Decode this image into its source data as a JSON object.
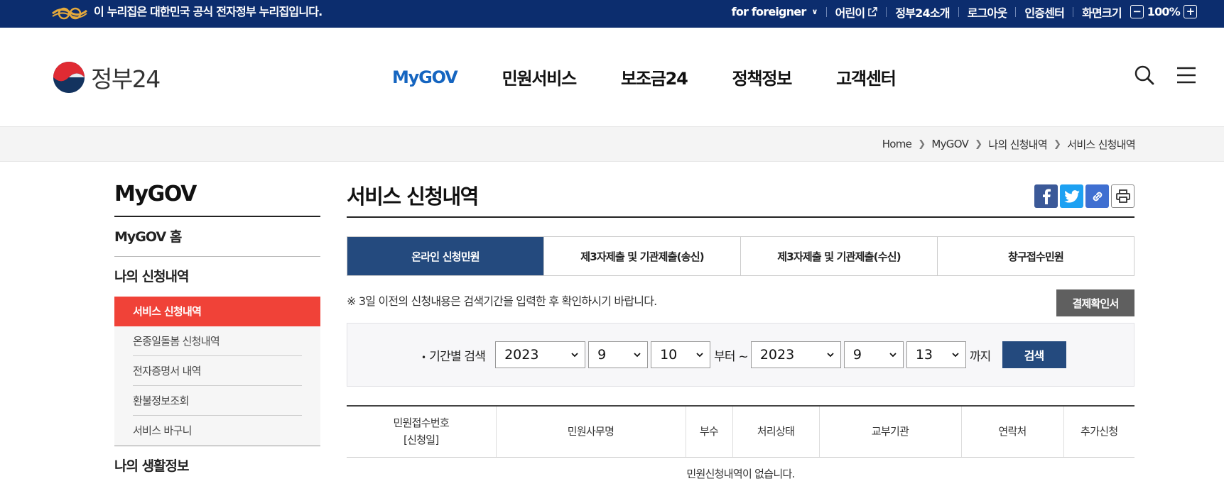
{
  "topbar": {
    "notice": "이 누리집은 대한민국 공식 전자정부 누리집입니다.",
    "links": [
      "for foreigner",
      "어린이",
      "정부24소개",
      "로그아웃",
      "인증센터",
      "화면크기"
    ],
    "zoom": "100%",
    "zoom_minus": "−",
    "zoom_plus": "+"
  },
  "header": {
    "logo_text": "정부24",
    "nav": [
      "MyGOV",
      "민원서비스",
      "보조금24",
      "정책정보",
      "고객센터"
    ]
  },
  "breadcrumb": [
    "Home",
    "MyGOV",
    "나의 신청내역",
    "서비스 신청내역"
  ],
  "sidebar": {
    "title": "MyGOV",
    "home": "MyGOV 홈",
    "section": "나의 신청내역",
    "sub": [
      "서비스 신청내역",
      "온종일돌봄 신청내역",
      "전자증명서 내역",
      "환불정보조회",
      "서비스 바구니"
    ],
    "next_section": "나의 생활정보"
  },
  "main": {
    "title": "서비스 신청내역",
    "tabs": [
      "온라인 신청민원",
      "제3자제출 및 기관제출(송신)",
      "제3자제출 및 기관제출(수신)",
      "창구접수민원"
    ],
    "notice": "※ 3일 이전의 신청내용은 검색기간을 입력한 후 확인하시기 바랍니다.",
    "confirm_button": "결제확인서",
    "search": {
      "label": "기간별 검색",
      "from_year": "2023",
      "from_month": "9",
      "from_day": "10",
      "from_suffix": "부터 ~",
      "to_year": "2023",
      "to_month": "9",
      "to_day": "13",
      "to_suffix": "까지",
      "button": "검색"
    },
    "table": {
      "headers": [
        "민원접수번호",
        "[신청일]",
        "민원사무명",
        "부수",
        "처리상태",
        "교부기관",
        "연락처",
        "추가신청"
      ],
      "empty": "민원신청내역이 없습니다."
    }
  },
  "colors": {
    "topbar": "#0c2d6e",
    "accent_blue": "#244a7e",
    "active_menu": "#f04238",
    "nav_active": "#1565c0"
  }
}
